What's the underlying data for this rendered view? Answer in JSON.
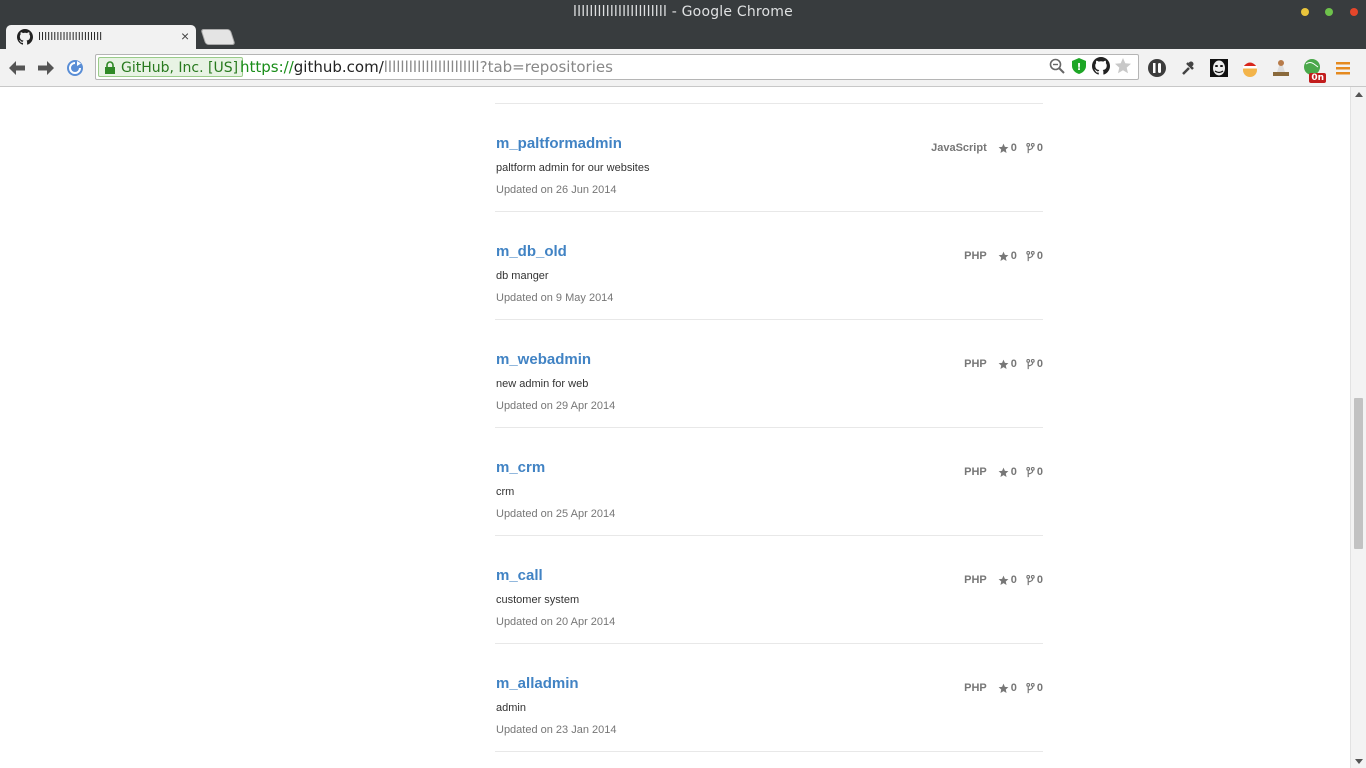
{
  "window": {
    "title": "lllllllllllllllllllllll - Google Chrome"
  },
  "tab": {
    "label": "lllllllllllllllllllll",
    "close": "×"
  },
  "omnibox": {
    "ev_label": "GitHub, Inc. [US]",
    "url_scheme": "https://",
    "url_host": "github.com/",
    "url_path": "lllllllllllllllllllllll?tab=repositories"
  },
  "extensions": {
    "badge": "0n"
  },
  "repos": [
    {
      "name": "m_paltformadmin",
      "description": "paltform admin for our websites",
      "updated": "Updated on 26 Jun 2014",
      "language": "JavaScript",
      "stars": "0",
      "forks": "0"
    },
    {
      "name": "m_db_old",
      "description": "db manger",
      "updated": "Updated on 9 May 2014",
      "language": "PHP",
      "stars": "0",
      "forks": "0"
    },
    {
      "name": "m_webadmin",
      "description": "new admin for web",
      "updated": "Updated on 29 Apr 2014",
      "language": "PHP",
      "stars": "0",
      "forks": "0"
    },
    {
      "name": "m_crm",
      "description": "crm",
      "updated": "Updated on 25 Apr 2014",
      "language": "PHP",
      "stars": "0",
      "forks": "0"
    },
    {
      "name": "m_call",
      "description": "customer system",
      "updated": "Updated on 20 Apr 2014",
      "language": "PHP",
      "stars": "0",
      "forks": "0"
    },
    {
      "name": "m_alladmin",
      "description": "admin",
      "updated": "Updated on 23 Jan 2014",
      "language": "PHP",
      "stars": "0",
      "forks": "0"
    }
  ]
}
